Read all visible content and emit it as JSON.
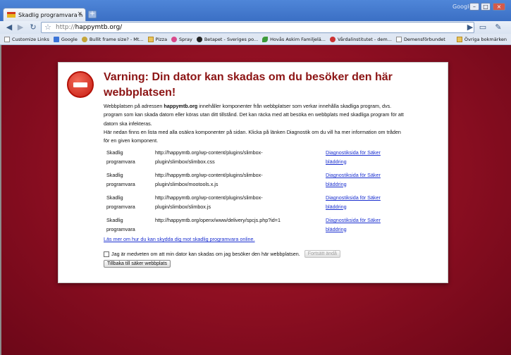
{
  "tab": {
    "title": "Skadlig programvara har u...",
    "close": "×"
  },
  "window": {
    "brand": "Google",
    "minimize": "–",
    "maximize": "□",
    "close": "×"
  },
  "toolbar": {
    "url_proto": "http://",
    "url_rest": "happymtb.org/",
    "back": "◀",
    "forward": "▶",
    "reload": "↻",
    "go": "▶",
    "page_menu": "▭",
    "tools_menu": "✎"
  },
  "bookmarks": [
    {
      "label": "Customize Links",
      "icon": "page-icon"
    },
    {
      "label": "Google",
      "icon": "google-icon"
    },
    {
      "label": "Bullit frame size? - Mt...",
      "icon": "bullit-icon"
    },
    {
      "label": "Pizza",
      "icon": "folder-icon"
    },
    {
      "label": "Spray",
      "icon": "spray-icon"
    },
    {
      "label": "Betapet - Sveriges po...",
      "icon": "betapet-icon"
    },
    {
      "label": "Hovås Askim Familjelä...",
      "icon": "leaf-icon"
    },
    {
      "label": "Vårdalinstitutet - dem...",
      "icon": "pin-icon"
    },
    {
      "label": "Demensförbundet",
      "icon": "page-icon"
    }
  ],
  "bookmarks_other": "Övriga bokmärken",
  "warning": {
    "heading": "Varning: Din dator kan skadas om du besöker den här webbplatsen!",
    "intro_prefix": "Webbplatsen på adressen ",
    "intro_site": "happymtb.org",
    "intro_suffix": " innehåller komponenter från webbplatser som verkar innehålla skadliga program, dvs. program som kan skada datorn eller köras utan ditt tillstånd. Det kan räcka med att besöka en webbplats med skadliga program för att datorn ska infekteras.",
    "intro_line2": "Här nedan finns en lista med alla osäkra komponenter på sidan. Klicka på länken Diagnostik om du vill ha mer information om tråden för en given komponent."
  },
  "components": [
    {
      "type": "Skadlig programvara",
      "url": "http://happymtb.org/wp-content/plugins/slimbox-plugin/slimbox/slimbox.css",
      "link": "Diagnostiksida för Säker bläddring"
    },
    {
      "type": "Skadlig programvara",
      "url": "http://happymtb.org/wp-content/plugins/slimbox-plugin/slimbox/mootools.x.js",
      "link": "Diagnostiksida för Säker bläddring"
    },
    {
      "type": "Skadlig programvara",
      "url": "http://happymtb.org/wp-content/plugins/slimbox-plugin/slimbox/slimbox.js",
      "link": "Diagnostiksida för Säker bläddring"
    },
    {
      "type": "Skadlig programvara",
      "url": "http://happymtb.org/openx/www/delivery/spcjs.php?id=1",
      "link": "Diagnostiksida för Säker bläddring"
    }
  ],
  "learn_more": "Läs mer om hur du kan skydda dig mot skadlig programvara online.",
  "confirm_label": "Jag är medveten om att min dator kan skadas om jag besöker den här webbplatsen.",
  "continue_button": "Fortsätt ändå",
  "back_button": "Tillbaka till säker webbplats"
}
